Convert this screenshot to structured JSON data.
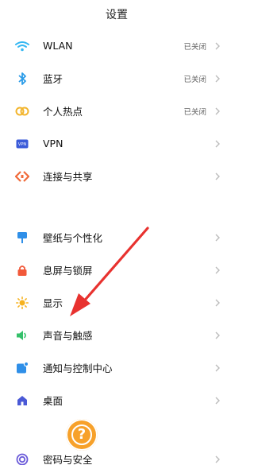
{
  "header": {
    "title": "设置"
  },
  "group1": [
    {
      "label": "WLAN",
      "status": "已关闭",
      "icon": "wifi-icon",
      "color": "#35b7f2"
    },
    {
      "label": "蓝牙",
      "status": "已关闭",
      "icon": "bluetooth-icon",
      "color": "#2a9be8"
    },
    {
      "label": "个人热点",
      "status": "已关闭",
      "icon": "hotspot-icon",
      "color": "#f2b52e"
    },
    {
      "label": "VPN",
      "icon": "vpn-icon",
      "color": "#3b5bd9"
    },
    {
      "label": "连接与共享",
      "icon": "connection-share-icon",
      "color": "#f06a3a"
    }
  ],
  "group2": [
    {
      "label": "壁纸与个性化",
      "icon": "wallpaper-icon",
      "color": "#2f8fe8"
    },
    {
      "label": "息屏与锁屏",
      "icon": "lock-screen-icon",
      "color": "#f2593a"
    },
    {
      "label": "显示",
      "icon": "display-icon",
      "color": "#f6b21f"
    },
    {
      "label": "声音与触感",
      "icon": "sound-icon",
      "color": "#34c06a"
    },
    {
      "label": "通知与控制中心",
      "icon": "notification-icon",
      "color": "#2f8fe8"
    },
    {
      "label": "桌面",
      "icon": "desktop-icon",
      "color": "#4a59d6"
    }
  ],
  "group3": [
    {
      "label": "密码与安全",
      "icon": "password-security-icon",
      "color": "#6a5ad9"
    }
  ],
  "annotation": {
    "arrow_color": "#e8322f",
    "help_badge_color": "#f7a12a",
    "help_symbol": "?"
  }
}
